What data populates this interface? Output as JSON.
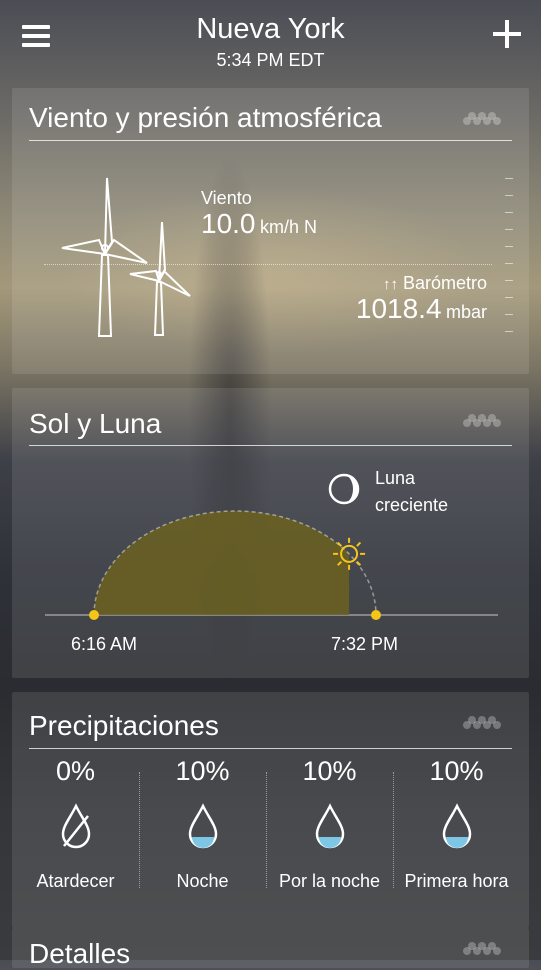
{
  "header": {
    "city": "Nueva York",
    "time": "5:34 PM EDT"
  },
  "wind_card": {
    "title": "Viento y presión atmosférica",
    "wind_label": "Viento",
    "wind_value": "10.0",
    "wind_unit": "km/h N",
    "pressure_label": "Barómetro",
    "pressure_arrows": "↑↑",
    "pressure_value": "1018.4",
    "pressure_unit": "mbar"
  },
  "sun_card": {
    "title": "Sol y Luna",
    "moon_line1": "Luna",
    "moon_line2": "creciente",
    "sunrise": "6:16 AM",
    "sunset": "7:32 PM",
    "day_progress": 0.8
  },
  "precip_card": {
    "title": "Precipitaciones",
    "items": [
      {
        "pct": "0%",
        "label": "Atardecer",
        "icon": "no-rain-drop-icon"
      },
      {
        "pct": "10%",
        "label": "Noche",
        "icon": "rain-drop-icon"
      },
      {
        "pct": "10%",
        "label": "Por la noche",
        "icon": "rain-drop-icon"
      },
      {
        "pct": "10%",
        "label": "Primera hora",
        "icon": "rain-drop-icon"
      }
    ]
  },
  "details_card": {
    "title": "Detalles"
  },
  "colors": {
    "sun": "#f5c518",
    "arc_fill": "#6b6020"
  }
}
